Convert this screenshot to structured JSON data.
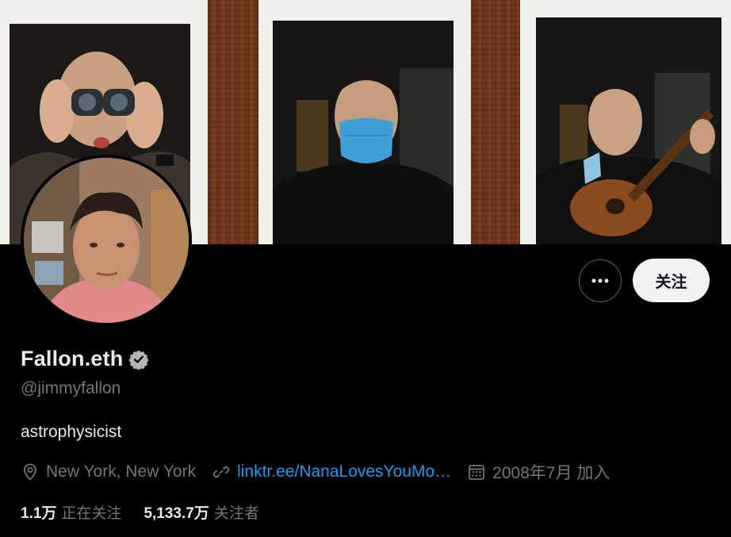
{
  "profile": {
    "display_name": "Fallon.eth",
    "handle": "@jimmyfallon",
    "bio": "astrophysicist",
    "location": "New York, New York",
    "website": "linktr.ee/NanaLovesYouMo…",
    "joined": "2008年7月 加入",
    "verified": true
  },
  "actions": {
    "more_label": "•••",
    "follow_label": "关注"
  },
  "stats": {
    "following_count": "1.1万",
    "following_label": "正在关注",
    "followers_count": "5,133.7万",
    "followers_label": "关注者"
  },
  "colors": {
    "background": "#000000",
    "primary_text": "#e7e9ea",
    "secondary_text": "#71767b",
    "link": "#1d9bf0",
    "follow_button_bg": "#eff3f4"
  },
  "icons": {
    "verified": "verified-badge-icon",
    "location": "location-pin-icon",
    "link": "link-icon",
    "calendar": "calendar-icon",
    "more": "more-horizontal-icon"
  }
}
